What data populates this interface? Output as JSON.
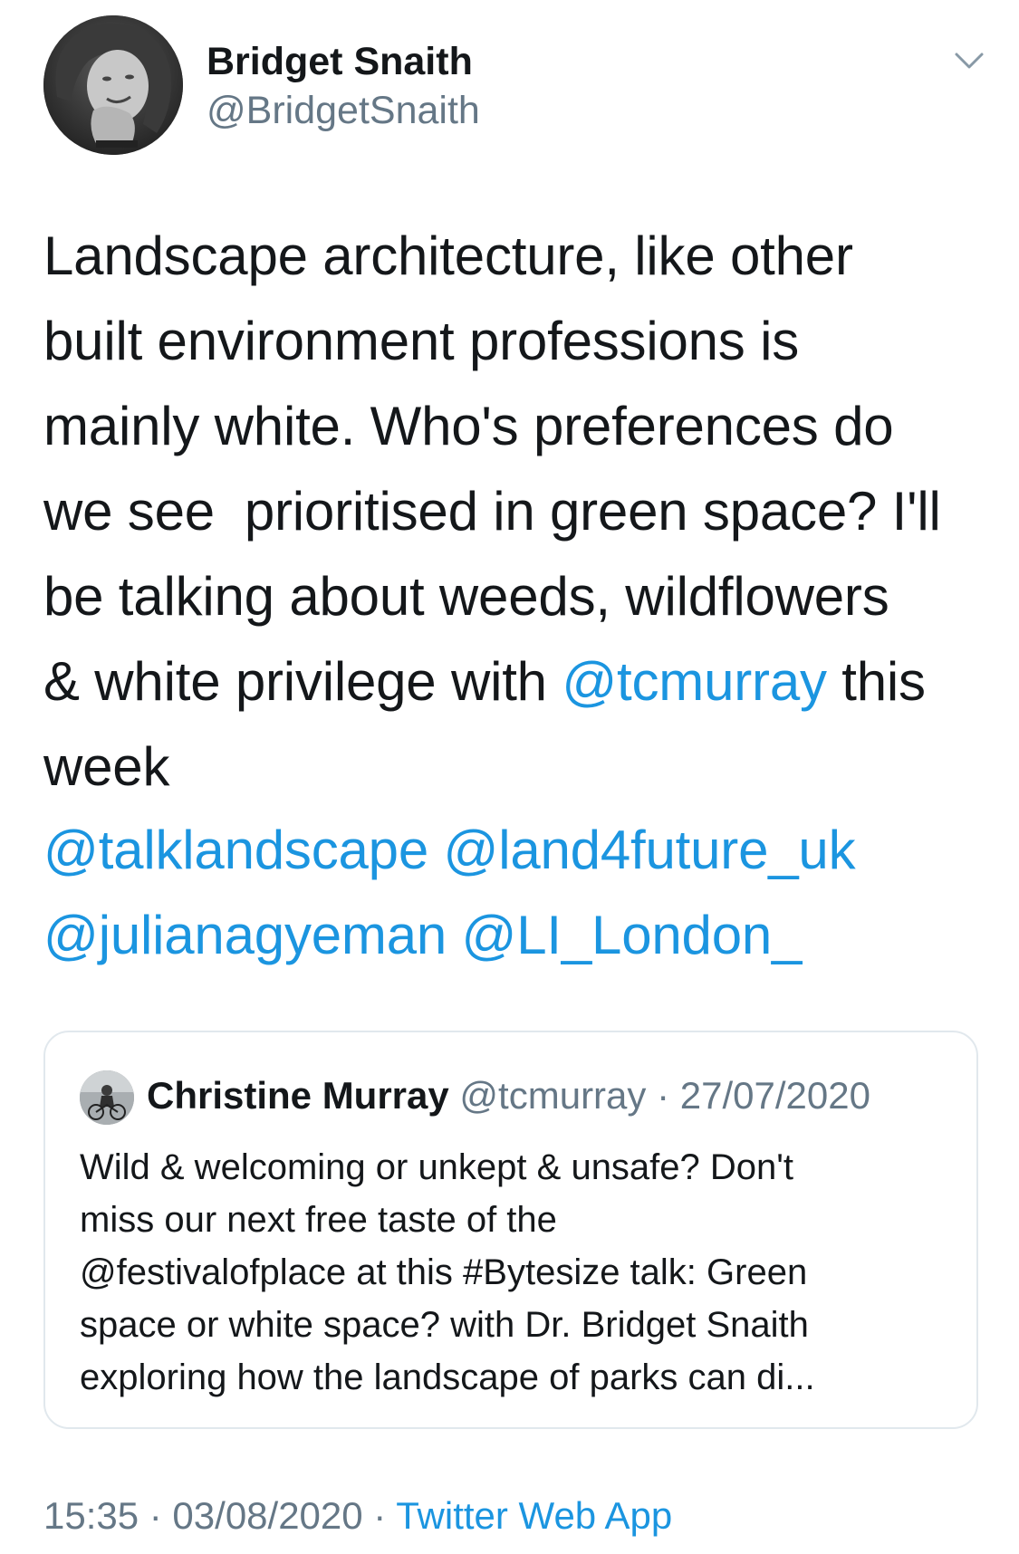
{
  "author": {
    "name": "Bridget Snaith",
    "handle": "@BridgetSnaith",
    "avatar_icon": "user-avatar"
  },
  "menu_icon": "chevron-down-icon",
  "tweet": {
    "lines": [
      "Landscape architecture, like other",
      "built environment professions is",
      "mainly white. Who's preferences do",
      "we see  prioritised in green space? I'll",
      "be talking about weeds, wildflowers"
    ],
    "line6_prefix": "& white privilege with ",
    "line6_mention": "@tcmurray",
    "line6_suffix": " this",
    "line7": "week",
    "mention_lines": [
      "@talklandscape @land4future_uk",
      "@julianagyeman @LI_London_"
    ]
  },
  "quoted_tweet": {
    "name": "Christine Murray",
    "meta": " @tcmurray · 27/07/2020",
    "lines": [
      "Wild & welcoming or unkept & unsafe? Don't",
      "miss our next free taste of the",
      "@festivalofplace at this #Bytesize talk: Green",
      "space or white space? with Dr. Bridget Snaith",
      "exploring how the landscape of parks can di..."
    ]
  },
  "footer": {
    "timestamp": "15:35 · 03/08/2020 · ",
    "source": "Twitter Web App"
  },
  "colors": {
    "text": "#14171a",
    "secondary": "#657786",
    "link": "#1b95e0",
    "border": "#e1e8ed"
  }
}
